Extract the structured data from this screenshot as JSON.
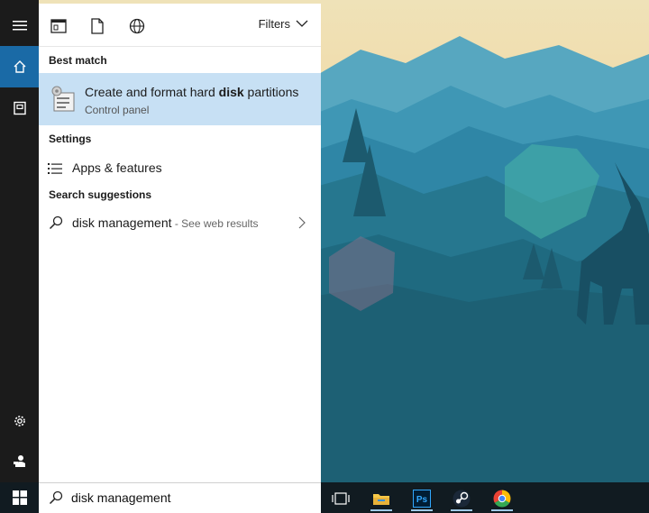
{
  "wallpaper": {
    "desc_colors": {
      "sky": "#f2d79b",
      "mountains": "#2c8aa8",
      "foreground": "#1f5f78"
    }
  },
  "rail": {
    "icons": [
      "hamburger-icon",
      "home-icon",
      "notebook-icon",
      "gear-icon",
      "feedback-icon"
    ]
  },
  "panel": {
    "scopes": [
      "apps-icon",
      "documents-icon",
      "web-icon"
    ],
    "filters_label": "Filters",
    "best_match_heading": "Best match",
    "best_match": {
      "title_before": "Create and format hard ",
      "title_bold": "disk",
      "title_after": " partitions",
      "subtitle": "Control panel"
    },
    "settings_heading": "Settings",
    "settings_item": "Apps & features",
    "suggestions_heading": "Search suggestions",
    "suggestion": {
      "text": "disk management",
      "extra": " - See web results"
    }
  },
  "taskbar": {
    "search_value": "disk management",
    "apps": [
      "task-view-icon",
      "file-explorer-icon",
      "photoshop-icon",
      "steam-icon",
      "chrome-icon"
    ],
    "photoshop_label": "Ps"
  },
  "colors": {
    "accent": "#1a6aa6",
    "highlight": "#c7e0f4",
    "rail": "#1b1b1b",
    "taskbar": "#111b21"
  }
}
